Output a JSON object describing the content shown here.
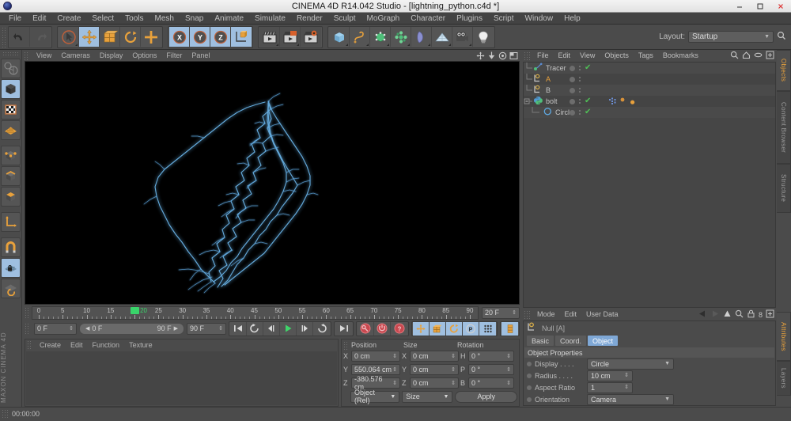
{
  "window": {
    "title": "CINEMA 4D R14.042 Studio - [lightning_python.c4d *]",
    "logo_icon": "c4d-logo-icon",
    "minimize_label": "—",
    "maximize_label": "▢",
    "close_label": "✕"
  },
  "menubar": {
    "items": [
      {
        "label": "File"
      },
      {
        "label": "Edit"
      },
      {
        "label": "Create"
      },
      {
        "label": "Select"
      },
      {
        "label": "Tools"
      },
      {
        "label": "Mesh"
      },
      {
        "label": "Snap"
      },
      {
        "label": "Animate"
      },
      {
        "label": "Simulate"
      },
      {
        "label": "Render"
      },
      {
        "label": "Sculpt"
      },
      {
        "label": "MoGraph"
      },
      {
        "label": "Character"
      },
      {
        "label": "Plugins"
      },
      {
        "label": "Script"
      },
      {
        "label": "Window"
      },
      {
        "label": "Help"
      }
    ]
  },
  "toolbar": {
    "undo_icon": "undo-arrow-icon",
    "redo_icon": "redo-arrow-icon",
    "live_select_icon": "live-select-cursor-icon",
    "move_icon": "move-tool-icon",
    "scale_icon": "scale-tool-icon",
    "rotate_icon": "rotate-tool-icon",
    "add_icon": "plus-tool-icon",
    "x_axis_label": "X",
    "y_axis_label": "Y",
    "z_axis_label": "Z",
    "world_axis_icon": "world-coordinate-cube-icon",
    "render_view_icon": "render-view-clapper-icon",
    "render_region_icon": "render-region-clapper-icon",
    "render_settings_icon": "render-settings-clapper-gear-icon",
    "cube_icon": "primitive-cube-icon",
    "spline_icon": "spline-pen-icon",
    "nurbs_icon": "generator-nurbs-icon",
    "mograph_icon": "mograph-cloner-icon",
    "deformer_icon": "deformer-bend-icon",
    "scene_icon": "scene-floor-icon",
    "camera_icon": "camera-icon",
    "light_icon": "light-bulb-icon",
    "layout_label": "Layout:",
    "layout_value": "Startup",
    "layout_search_icon": "search-icon"
  },
  "left_tools": {
    "items": [
      {
        "name": "make-editable-icon",
        "active": false
      },
      {
        "name": "model-mode-cube-icon",
        "active": true
      },
      {
        "name": "texture-mode-checker-icon",
        "active": false
      },
      {
        "name": "workplane-grid-icon",
        "active": false
      },
      {
        "name": "points-mode-icon",
        "active": false
      },
      {
        "name": "edges-mode-icon",
        "active": false
      },
      {
        "name": "polygons-mode-icon",
        "active": false
      },
      {
        "name": "object-axis-icon",
        "active": false
      },
      {
        "name": "enable-snap-magnet-icon",
        "active": false
      },
      {
        "name": "workplane-lock-icon",
        "active": true
      },
      {
        "name": "workplane-rotate-icon",
        "active": false
      }
    ],
    "brand_top": "MAXON",
    "brand_bottom": "CINEMA 4D"
  },
  "viewport": {
    "menus": [
      {
        "label": "View"
      },
      {
        "label": "Cameras"
      },
      {
        "label": "Display"
      },
      {
        "label": "Options"
      },
      {
        "label": "Filter"
      },
      {
        "label": "Panel"
      }
    ],
    "nav_icons": [
      {
        "name": "pan-view-icon"
      },
      {
        "name": "dolly-view-icon"
      },
      {
        "name": "rotate-view-icon"
      },
      {
        "name": "maximize-view-icon"
      }
    ],
    "background_color": "#000000",
    "lightning_color": "#6ab4e8",
    "lightning_glow_color": "#2e6f9e",
    "scene_description": "Procedural lightning bolt spline rendered as multiple jagged blue strands running diagonally from lower-left to upper-right with fine branch filaments"
  },
  "timeline": {
    "min_frame_label": "0",
    "max_frame_label": "90",
    "tick_labels": [
      "0",
      "5",
      "10",
      "15",
      "20",
      "25",
      "30",
      "35",
      "40",
      "45",
      "50",
      "55",
      "60",
      "65",
      "70",
      "75",
      "80",
      "85",
      "90"
    ],
    "playhead_frame": 20,
    "playhead_label": "20",
    "current_frame_field": "0 F",
    "range_start_field": "0 F",
    "range_end_field": "90 F",
    "preview_end_field": "90 F",
    "document_end_field": "20 F",
    "transport": [
      {
        "name": "go-to-start-button",
        "glyph": "⏮"
      },
      {
        "name": "play-backwards-button",
        "glyph": "↺"
      },
      {
        "name": "step-back-button",
        "glyph": "◀|"
      },
      {
        "name": "play-forward-button",
        "glyph": "▶"
      },
      {
        "name": "step-forward-button",
        "glyph": "|▶"
      },
      {
        "name": "play-loop-button",
        "glyph": "↻"
      },
      {
        "name": "go-to-end-button",
        "glyph": "⏭"
      }
    ],
    "record_buttons": [
      {
        "name": "record-active-objects-button"
      },
      {
        "name": "autokeying-button"
      },
      {
        "name": "keyframe-selection-button"
      }
    ],
    "param_buttons": [
      {
        "name": "position-key-toggle",
        "active": true
      },
      {
        "name": "scale-key-toggle",
        "active": true
      },
      {
        "name": "rotation-key-toggle",
        "active": true
      },
      {
        "name": "parameter-key-toggle",
        "active": true
      },
      {
        "name": "pla-key-toggle",
        "active": false
      },
      {
        "name": "keyframe-options-button",
        "active": true
      }
    ]
  },
  "material_manager": {
    "menus": [
      {
        "label": "Create"
      },
      {
        "label": "Edit"
      },
      {
        "label": "Function"
      },
      {
        "label": "Texture"
      }
    ]
  },
  "coordinates": {
    "headers": {
      "position": "Position",
      "size": "Size",
      "rotation": "Rotation"
    },
    "rows": [
      {
        "pos_axis": "X",
        "pos_value": "0 cm",
        "size_axis": "X",
        "size_value": "0 cm",
        "rot_axis": "H",
        "rot_value": "0 °"
      },
      {
        "pos_axis": "Y",
        "pos_value": "550.064 cm",
        "size_axis": "Y",
        "size_value": "0 cm",
        "rot_axis": "P",
        "rot_value": "0 °"
      },
      {
        "pos_axis": "Z",
        "pos_value": "-380.576 cm",
        "size_axis": "Z",
        "size_value": "0 cm",
        "rot_axis": "B",
        "rot_value": "0 °"
      }
    ],
    "mode_dropdown": "Object (Rel)",
    "size_dropdown": "Size",
    "apply_label": "Apply"
  },
  "object_manager": {
    "menus": [
      {
        "label": "File"
      },
      {
        "label": "Edit"
      },
      {
        "label": "View"
      },
      {
        "label": "Objects"
      },
      {
        "label": "Tags"
      },
      {
        "label": "Bookmarks"
      }
    ],
    "header_icons": [
      {
        "name": "search-icon"
      },
      {
        "name": "home-icon"
      },
      {
        "name": "ellipse-icon"
      },
      {
        "name": "add-panel-icon"
      }
    ],
    "objects": [
      {
        "label": "Tracer",
        "icon": "tracer-object-icon",
        "depth": 0,
        "selected": false,
        "visible_dot": true,
        "checked": true,
        "tags": []
      },
      {
        "label": "A",
        "icon": "null-object-icon",
        "depth": 0,
        "selected": true,
        "visible_dot": true,
        "checked": false,
        "tags": []
      },
      {
        "label": "B",
        "icon": "null-object-icon",
        "depth": 0,
        "selected": false,
        "visible_dot": true,
        "checked": false,
        "tags": []
      },
      {
        "label": "bolt",
        "icon": "python-generator-icon",
        "depth": 0,
        "selected": false,
        "visible_dot": true,
        "checked": true,
        "tags": [
          {
            "name": "python-tag",
            "color": "#6d8fd6"
          },
          {
            "name": "sweep-tag",
            "color": "#d8923a"
          },
          {
            "name": "material-tag",
            "color": "#d8923a"
          }
        ]
      },
      {
        "label": "Circle",
        "icon": "circle-spline-icon",
        "depth": 1,
        "selected": false,
        "visible_dot": true,
        "checked": true,
        "tags": []
      }
    ],
    "tabs": [
      {
        "label": "Objects",
        "active": true
      },
      {
        "label": "Content Browser",
        "active": false
      },
      {
        "label": "Structure",
        "active": false
      }
    ]
  },
  "attributes": {
    "menus": [
      {
        "label": "Mode"
      },
      {
        "label": "Edit"
      },
      {
        "label": "User Data"
      }
    ],
    "header_icons": [
      {
        "name": "back-arrow-icon"
      },
      {
        "name": "forward-arrow-icon"
      },
      {
        "name": "up-arrow-icon"
      },
      {
        "name": "search-icon"
      },
      {
        "name": "lock-icon"
      },
      {
        "name": "count-8-label"
      },
      {
        "name": "add-panel-icon"
      }
    ],
    "object_icon": "null-object-icon",
    "object_title": "Null [A]",
    "tabs": [
      {
        "label": "Basic",
        "active": false
      },
      {
        "label": "Coord.",
        "active": false
      },
      {
        "label": "Object",
        "active": true
      }
    ],
    "section_title": "Object Properties",
    "properties": [
      {
        "label": "Display . . . .",
        "value": "Circle",
        "type": "dropdown"
      },
      {
        "label": "Radius . . . .",
        "value": "10 cm",
        "type": "number"
      },
      {
        "label": "Aspect Ratio",
        "value": "1",
        "type": "number"
      },
      {
        "label": "Orientation",
        "value": "Camera",
        "type": "dropdown"
      }
    ],
    "tabs_vertical": [
      {
        "label": "Attributes",
        "active": true
      },
      {
        "label": "Layers",
        "active": false
      }
    ]
  },
  "statusbar": {
    "text": "00:00:00"
  },
  "colors": {
    "accent_blue": "#7fa8d6",
    "selected_orange": "#e8a13c",
    "panel_bg": "#4b4b4b",
    "field_bg": "#5c5c5c",
    "check_green": "#4fbf55",
    "playhead_green": "#39d46a"
  }
}
